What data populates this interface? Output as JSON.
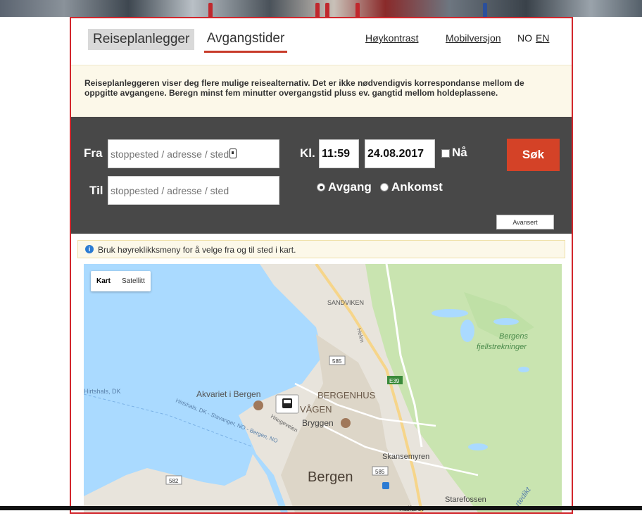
{
  "tabs": {
    "planner": "Reiseplanlegger",
    "departures": "Avgangstider"
  },
  "links": {
    "high_contrast": "Høykontrast",
    "mobile": "Mobilversjon",
    "lang_no": "NO",
    "lang_en": "EN"
  },
  "info_text": "Reiseplanleggeren viser deg flere mulige reisealternativ. Det er ikke nødvendigvis korrespondanse mellom de oppgitte avgangene. Beregn minst fem minutter overgangstid pluss ev. gangtid mellom holdeplassene.",
  "search": {
    "from_label": "Fra",
    "to_label": "Til",
    "from_placeholder": "stoppested / adresse / sted",
    "to_placeholder": "stoppested / adresse / sted",
    "time_label": "Kl.",
    "time_value": "11:59",
    "date_value": "24.08.2017",
    "now_label": "Nå",
    "departure_label": "Avgang",
    "arrival_label": "Ankomst",
    "selected_mode": "Avgang",
    "search_button": "Søk",
    "advanced_button": "Avansert"
  },
  "hint": {
    "icon": "info-icon",
    "text": "Bruk høyreklikksmeny for å velge fra og til sted i kart."
  },
  "map": {
    "type_buttons": {
      "map": "Kart",
      "satellite": "Satellitt"
    },
    "labels": {
      "sandviken": "SANDVIKEN",
      "helen": "Helen",
      "road_585a": "585",
      "road_e39": "E39",
      "fjell": "Bergens fjellstrekninger",
      "hirtshals": "Hirtshals, DK",
      "route": "Hirtshals, DK - Stavanger, NO - Bergen, NO",
      "akvariet": "Akvariet i Bergen",
      "bergenhus": "BERGENHUS",
      "vagen": "VÅGEN",
      "haugeveien": "Haugeveien",
      "bryggen": "Bryggen",
      "skansemyren": "Skansemyren",
      "road_585b": "585",
      "bergen": "Bergen",
      "road_582": "582",
      "starefossen": "Starefossen",
      "kalfaret": "Kalfaret",
      "tredikt": "rtedikt"
    }
  },
  "colors": {
    "accent": "#d44227",
    "frame": "#d2262c",
    "search_bg": "#484848",
    "info_bg": "#fcf8e9"
  }
}
